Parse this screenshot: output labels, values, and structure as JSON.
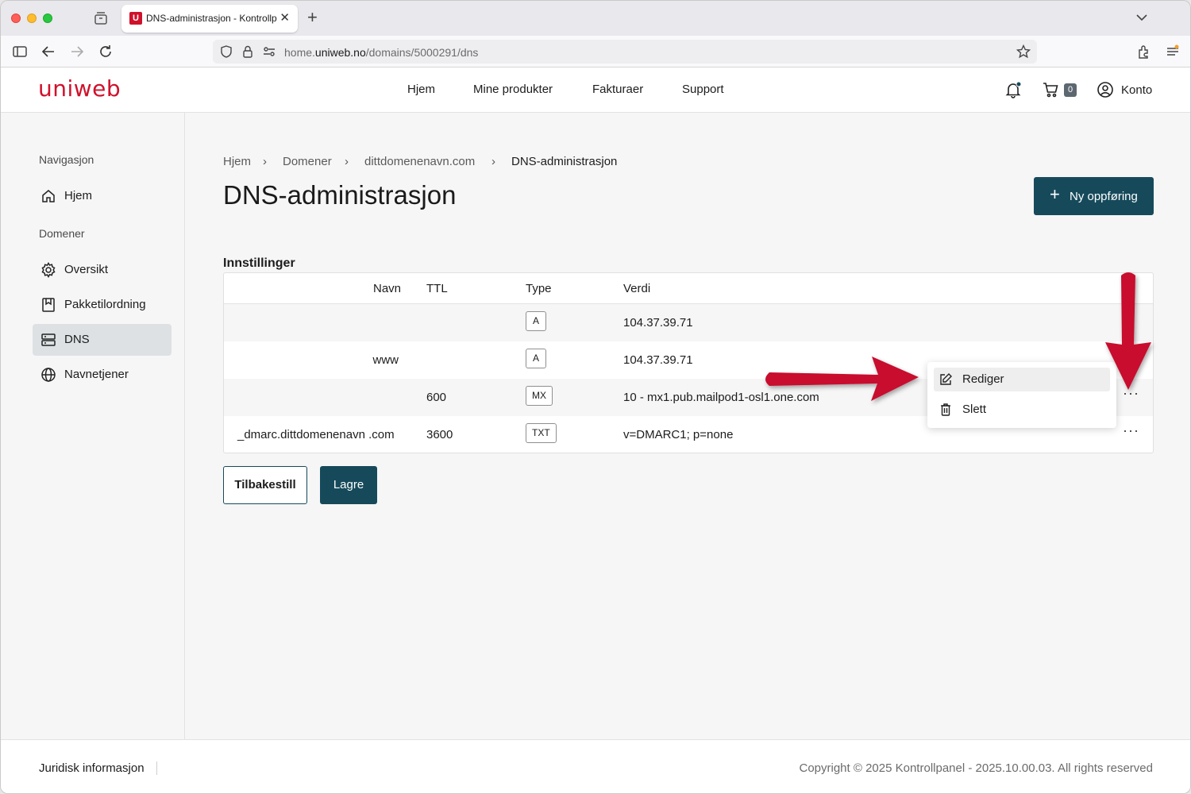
{
  "browser": {
    "tab_title": "DNS-administrasjon - Kontrollpanel",
    "tab_favicon": "U",
    "url_prefix": "home.",
    "url_host": "uniweb.no",
    "url_path": "/domains/5000291/dns"
  },
  "header": {
    "logo": "uniweb",
    "nav": [
      "Hjem",
      "Mine produkter",
      "Fakturaer",
      "Support"
    ],
    "cart_count": "0",
    "account_label": "Konto"
  },
  "sidebar": {
    "heading_nav": "Navigasjon",
    "home_label": "Hjem",
    "heading_domains": "Domener",
    "items": [
      {
        "label": "Oversikt",
        "icon": "gear-icon"
      },
      {
        "label": "Pakketilordning",
        "icon": "package-icon"
      },
      {
        "label": "DNS",
        "icon": "server-icon"
      },
      {
        "label": "Navnetjener",
        "icon": "globe-icon"
      }
    ]
  },
  "breadcrumb": [
    "Hjem",
    "Domener",
    "dittdomenenavn.com",
    "DNS-administrasjon"
  ],
  "page_title": "DNS-administrasjon",
  "new_record_button": "Ny oppføring",
  "section_title": "Innstillinger",
  "table": {
    "headers": [
      "Navn",
      "TTL",
      "Type",
      "Verdi"
    ],
    "rows": [
      {
        "name": "",
        "ttl": "",
        "type": "A",
        "value": "104.37.39.71"
      },
      {
        "name": "www",
        "ttl": "",
        "type": "A",
        "value": "104.37.39.71"
      },
      {
        "name": "",
        "ttl": "600",
        "type": "MX",
        "value": "10 - mx1.pub.mailpod1-osl1.one.com"
      },
      {
        "name": "_dmarc.dittdomenenavn .com",
        "ttl": "3600",
        "type": "TXT",
        "value": "v=DMARC1; p=none"
      }
    ]
  },
  "context_menu": {
    "edit": "Rediger",
    "delete": "Slett"
  },
  "buttons": {
    "reset": "Tilbakestill",
    "save": "Lagre"
  },
  "footer": {
    "legal": "Juridisk informasjon",
    "copyright": "Copyright © 2025 Kontrollpanel - 2025.10.00.03. All rights reserved"
  },
  "colors": {
    "brand": "#d0112b",
    "primary": "#164a5b",
    "annotation_arrow": "#c8102e"
  }
}
